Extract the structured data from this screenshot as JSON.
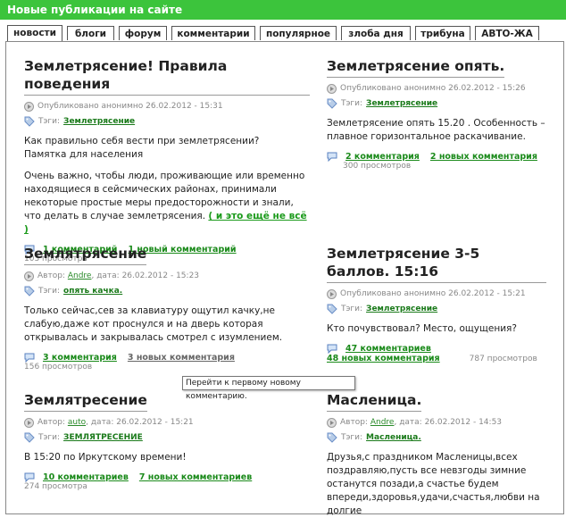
{
  "header": {
    "title": "Новые публикации на сайте"
  },
  "tabs": [
    {
      "label": "новости",
      "active": true
    },
    {
      "label": "блоги"
    },
    {
      "label": "форум"
    },
    {
      "label": "комментарии"
    },
    {
      "label": "популярное"
    },
    {
      "label": "злоба дня"
    },
    {
      "label": "трибуна"
    },
    {
      "label": "АВТО-ЖА"
    }
  ],
  "posts": [
    {
      "title": "Землетрясение! Правила поведения",
      "meta": "Опубликовано анонимно 26.02.2012 - 15:31",
      "tags_label": "Тэги:",
      "tag": "Землетрясение",
      "body_lines": [
        "Как правильно себя вести при землетрясении?",
        "Памятка для населения"
      ],
      "body2": "Очень важно, чтобы люди, проживающие или временно находящиеся в сейсмических районах, принимали некоторые простые меры предосторожности и знали, что делать в случае землетрясения.",
      "more": "( и это ещё не всё )",
      "comments": "1 комментарий",
      "new_comments": "1 новый комментарий",
      "views": "103 просмотра"
    },
    {
      "title": "Землетрясение опять.",
      "meta": "Опубликовано анонимно 26.02.2012 - 15:26",
      "tags_label": "Тэги:",
      "tag": "Землетрясение",
      "body": "Землетрясение опять 15.20 . Особенность – плавное горизонтальное раскачивание.",
      "comments": "2 комментария",
      "new_comments": "2 новых комментария",
      "views": "300 просмотров"
    },
    {
      "title": "Землятрясение",
      "meta_author_prefix": "Автор:",
      "author": "Andre",
      "meta_date": ", дата: 26.02.2012 - 15:23",
      "tags_label": "Тэги:",
      "tag": "опять качка.",
      "body": "Только сейчас,сев за клавиатуру ощутил качку,не слабую,даже кот проснулся и на дверь которая открывалась и закрывалась смотрел с изумлением.",
      "comments": "3 комментария",
      "new_comments": "3 новых комментария",
      "views": "156 просмотров"
    },
    {
      "title": "Землетрясение 3-5 баллов. 15:16",
      "meta": "Опубликовано анонимно 26.02.2012 - 15:21",
      "tags_label": "Тэги:",
      "tag": "Землетрясение",
      "body": "Кто почувствовал? Место, ощущения?",
      "comments": "47 комментариев",
      "new_comments": "48 новых комментария",
      "views": "787 просмотров"
    },
    {
      "title": "Землятресение",
      "meta_author_prefix": "Автор:",
      "author": "auto",
      "meta_date": ", дата: 26.02.2012 - 15:21",
      "tags_label": "Тэги:",
      "tag": "ЗЕМЛЯТРЕСЕНИЕ",
      "body": "В 15:20 по Иркутскому времени!",
      "comments": "10 комментариев",
      "new_comments": "7 новых комментариев",
      "views": "274 просмотра"
    },
    {
      "title": "Масленица.",
      "meta_author_prefix": "Автор:",
      "author": "Andre",
      "meta_date": ", дата: 26.02.2012 - 14:53",
      "tags_label": "Тэги:",
      "tag": "Масленица.",
      "body": "Друзья,с праздником Масленицы,всех поздравляю,пусть все невзгоды зимние останутся позади,а счастье будем впереди,здоровья,удачи,счастья,любви на долгие"
    }
  ],
  "tooltip": "Перейти к первому новому комментарию."
}
